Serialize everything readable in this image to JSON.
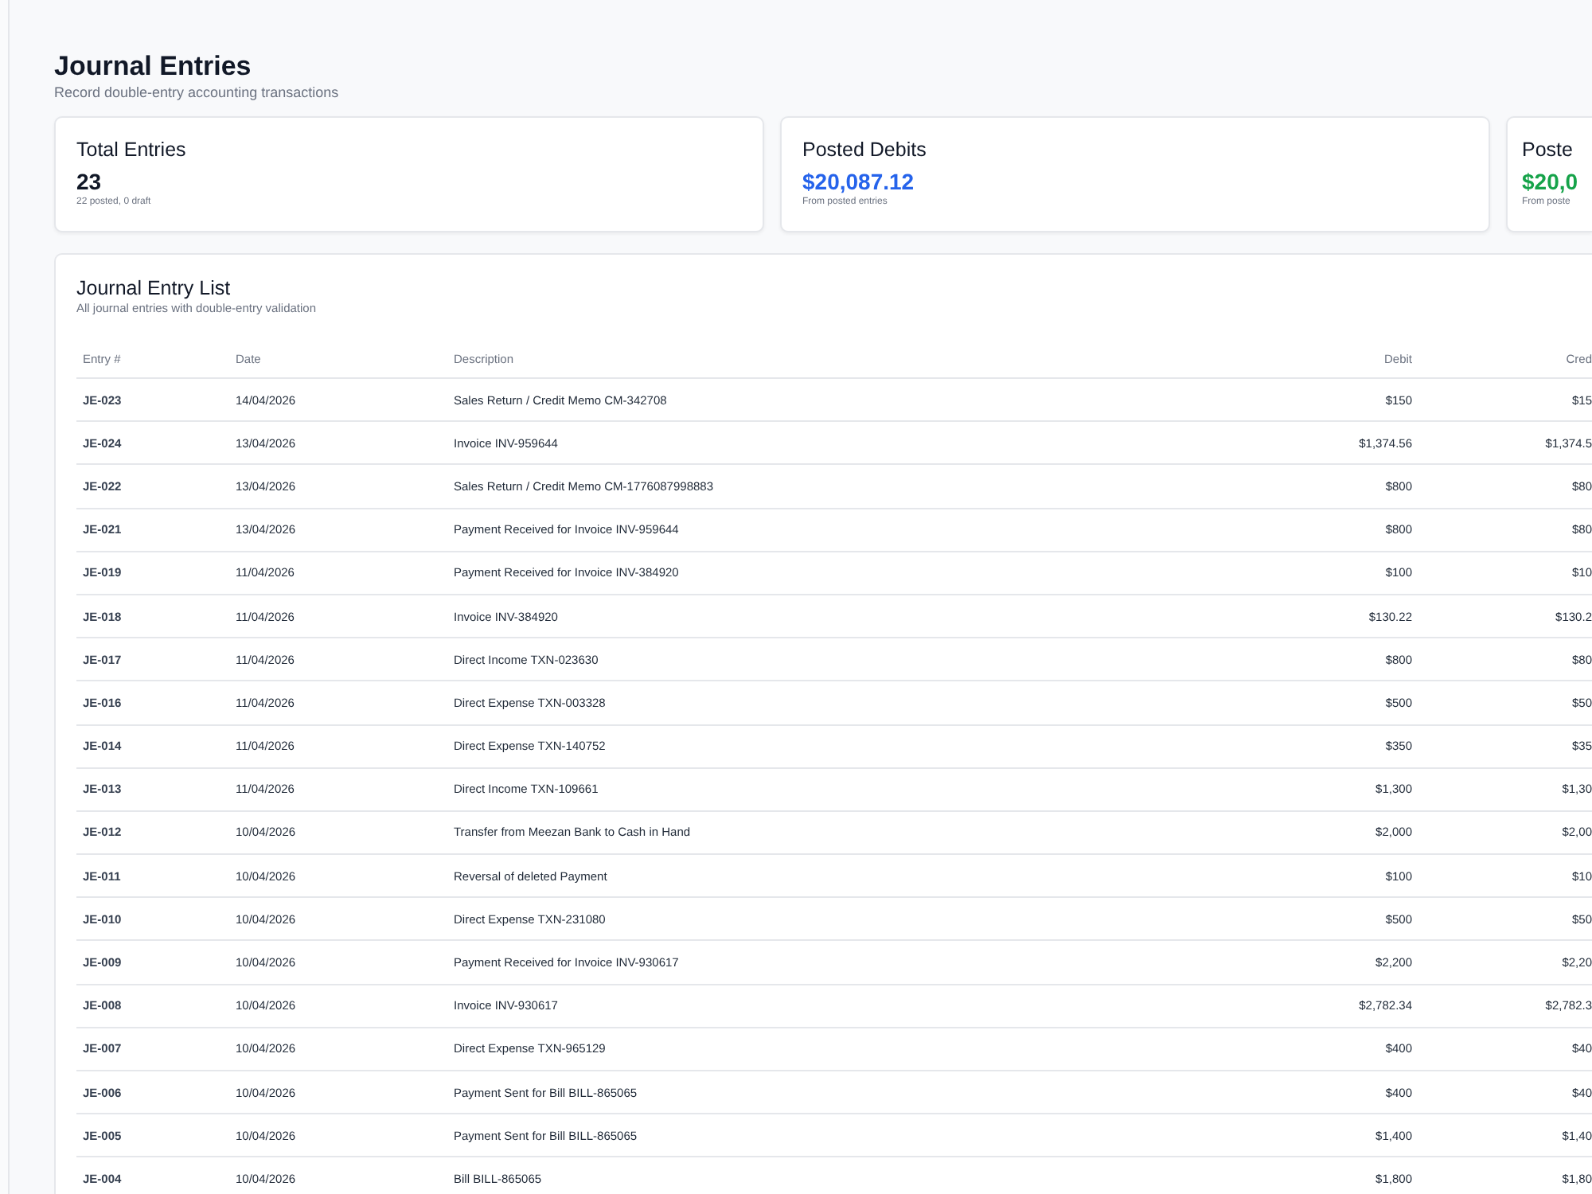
{
  "header": {
    "title": "Journal Entries",
    "subtitle": "Record double-entry accounting transactions"
  },
  "stats": [
    {
      "title": "Total Entries",
      "value": "23",
      "note": "22 posted, 0 draft",
      "color": "#111827"
    },
    {
      "title": "Posted Debits",
      "value": "$20,087.12",
      "note": "From posted entries",
      "color": "#2563eb"
    },
    {
      "title": "Poste",
      "value": "$20,0",
      "note": "From poste",
      "color": "#16a34a"
    }
  ],
  "table": {
    "title": "Journal Entry List",
    "subtitle": "All journal entries with double-entry validation",
    "columns": [
      "Entry #",
      "Date",
      "Description",
      "Debit",
      "Cred"
    ],
    "rows": [
      [
        "JE-023",
        "14/04/2026",
        "Sales Return / Credit Memo CM-342708",
        "$150",
        "$15"
      ],
      [
        "JE-024",
        "13/04/2026",
        "Invoice INV-959644",
        "$1,374.56",
        "$1,374.5"
      ],
      [
        "JE-022",
        "13/04/2026",
        "Sales Return / Credit Memo CM-1776087998883",
        "$800",
        "$80"
      ],
      [
        "JE-021",
        "13/04/2026",
        "Payment Received for Invoice INV-959644",
        "$800",
        "$80"
      ],
      [
        "JE-019",
        "11/04/2026",
        "Payment Received for Invoice INV-384920",
        "$100",
        "$10"
      ],
      [
        "JE-018",
        "11/04/2026",
        "Invoice INV-384920",
        "$130.22",
        "$130.2"
      ],
      [
        "JE-017",
        "11/04/2026",
        "Direct Income TXN-023630",
        "$800",
        "$80"
      ],
      [
        "JE-016",
        "11/04/2026",
        "Direct Expense TXN-003328",
        "$500",
        "$50"
      ],
      [
        "JE-014",
        "11/04/2026",
        "Direct Expense TXN-140752",
        "$350",
        "$35"
      ],
      [
        "JE-013",
        "11/04/2026",
        "Direct Income TXN-109661",
        "$1,300",
        "$1,30"
      ],
      [
        "JE-012",
        "10/04/2026",
        "Transfer from Meezan Bank to Cash in Hand",
        "$2,000",
        "$2,00"
      ],
      [
        "JE-011",
        "10/04/2026",
        "Reversal of deleted Payment",
        "$100",
        "$10"
      ],
      [
        "JE-010",
        "10/04/2026",
        "Direct Expense TXN-231080",
        "$500",
        "$50"
      ],
      [
        "JE-009",
        "10/04/2026",
        "Payment Received for Invoice INV-930617",
        "$2,200",
        "$2,20"
      ],
      [
        "JE-008",
        "10/04/2026",
        "Invoice INV-930617",
        "$2,782.34",
        "$2,782.3"
      ],
      [
        "JE-007",
        "10/04/2026",
        "Direct Expense TXN-965129",
        "$400",
        "$40"
      ],
      [
        "JE-006",
        "10/04/2026",
        "Payment Sent for Bill BILL-865065",
        "$400",
        "$40"
      ],
      [
        "JE-005",
        "10/04/2026",
        "Payment Sent for Bill BILL-865065",
        "$1,400",
        "$1,40"
      ],
      [
        "JE-004",
        "10/04/2026",
        "Bill BILL-865065",
        "$1,800",
        "$1,80"
      ]
    ]
  }
}
